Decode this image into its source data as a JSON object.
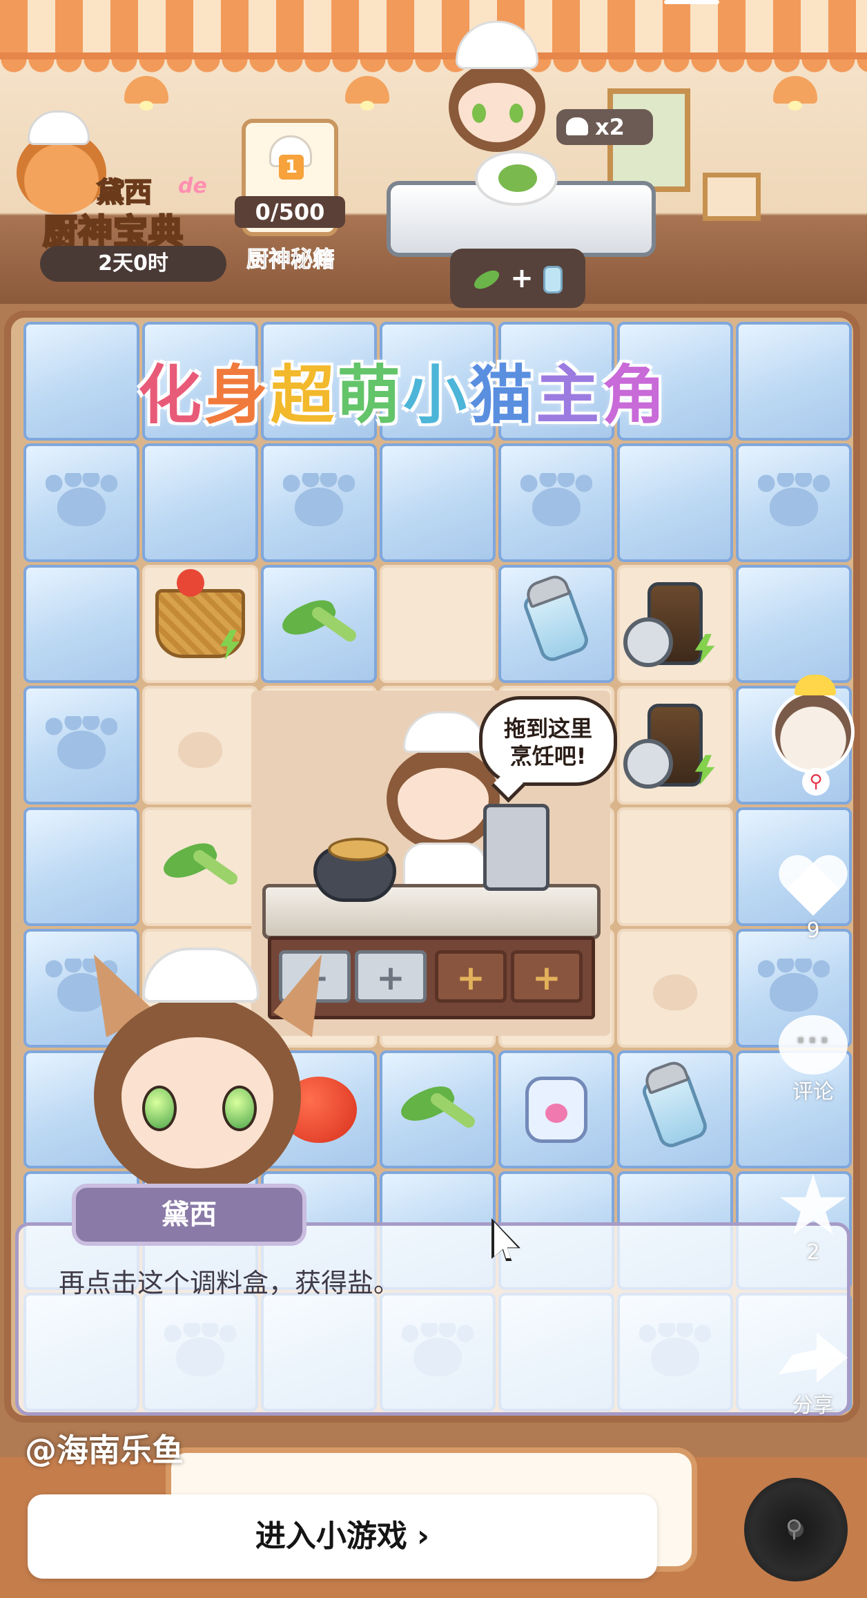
{
  "event": {
    "name": "黛西",
    "name_suffix": "de",
    "title": "厨神宝典",
    "timer": "2天0时"
  },
  "recipe_book": {
    "level": "1",
    "progress": "0/500",
    "label": "厨神秘籍"
  },
  "order": {
    "multiplier": "x2",
    "recipe_plus": "+"
  },
  "banner": {
    "chars": [
      {
        "text": "化",
        "color": "#e85b78"
      },
      {
        "text": "身",
        "color": "#f07a3c"
      },
      {
        "text": "超",
        "color": "#f2b92c"
      },
      {
        "text": "萌",
        "color": "#63c46a"
      },
      {
        "text": "小",
        "color": "#4cb5d8"
      },
      {
        "text": "猫",
        "color": "#5a8fe0"
      },
      {
        "text": "主",
        "color": "#9c7be0"
      },
      {
        "text": "角",
        "color": "#c86ad8"
      }
    ]
  },
  "kitchen": {
    "speech": "拖到这里烹饪吧!",
    "speech_line1": "拖到这里",
    "speech_line2": "烹饪吧!",
    "slot_symbol": "+"
  },
  "dialog": {
    "speaker": "黛西",
    "text": "再点击这个调料盒，获得盐。"
  },
  "social": {
    "like_count": "9",
    "comment_label": "评论",
    "comment_dots": "···",
    "favorite_count": "2",
    "share_label": "分享",
    "link_icon": "link-icon"
  },
  "footer": {
    "watermark": "@海南乐鱼",
    "enter_button": "进入小游戏",
    "enter_chevron": "›"
  },
  "colors": {
    "ice": "#bcd8f3",
    "floor": "#f6e6d2",
    "board_border": "#a46a45",
    "dialog_tag": "#8a7aa7"
  }
}
